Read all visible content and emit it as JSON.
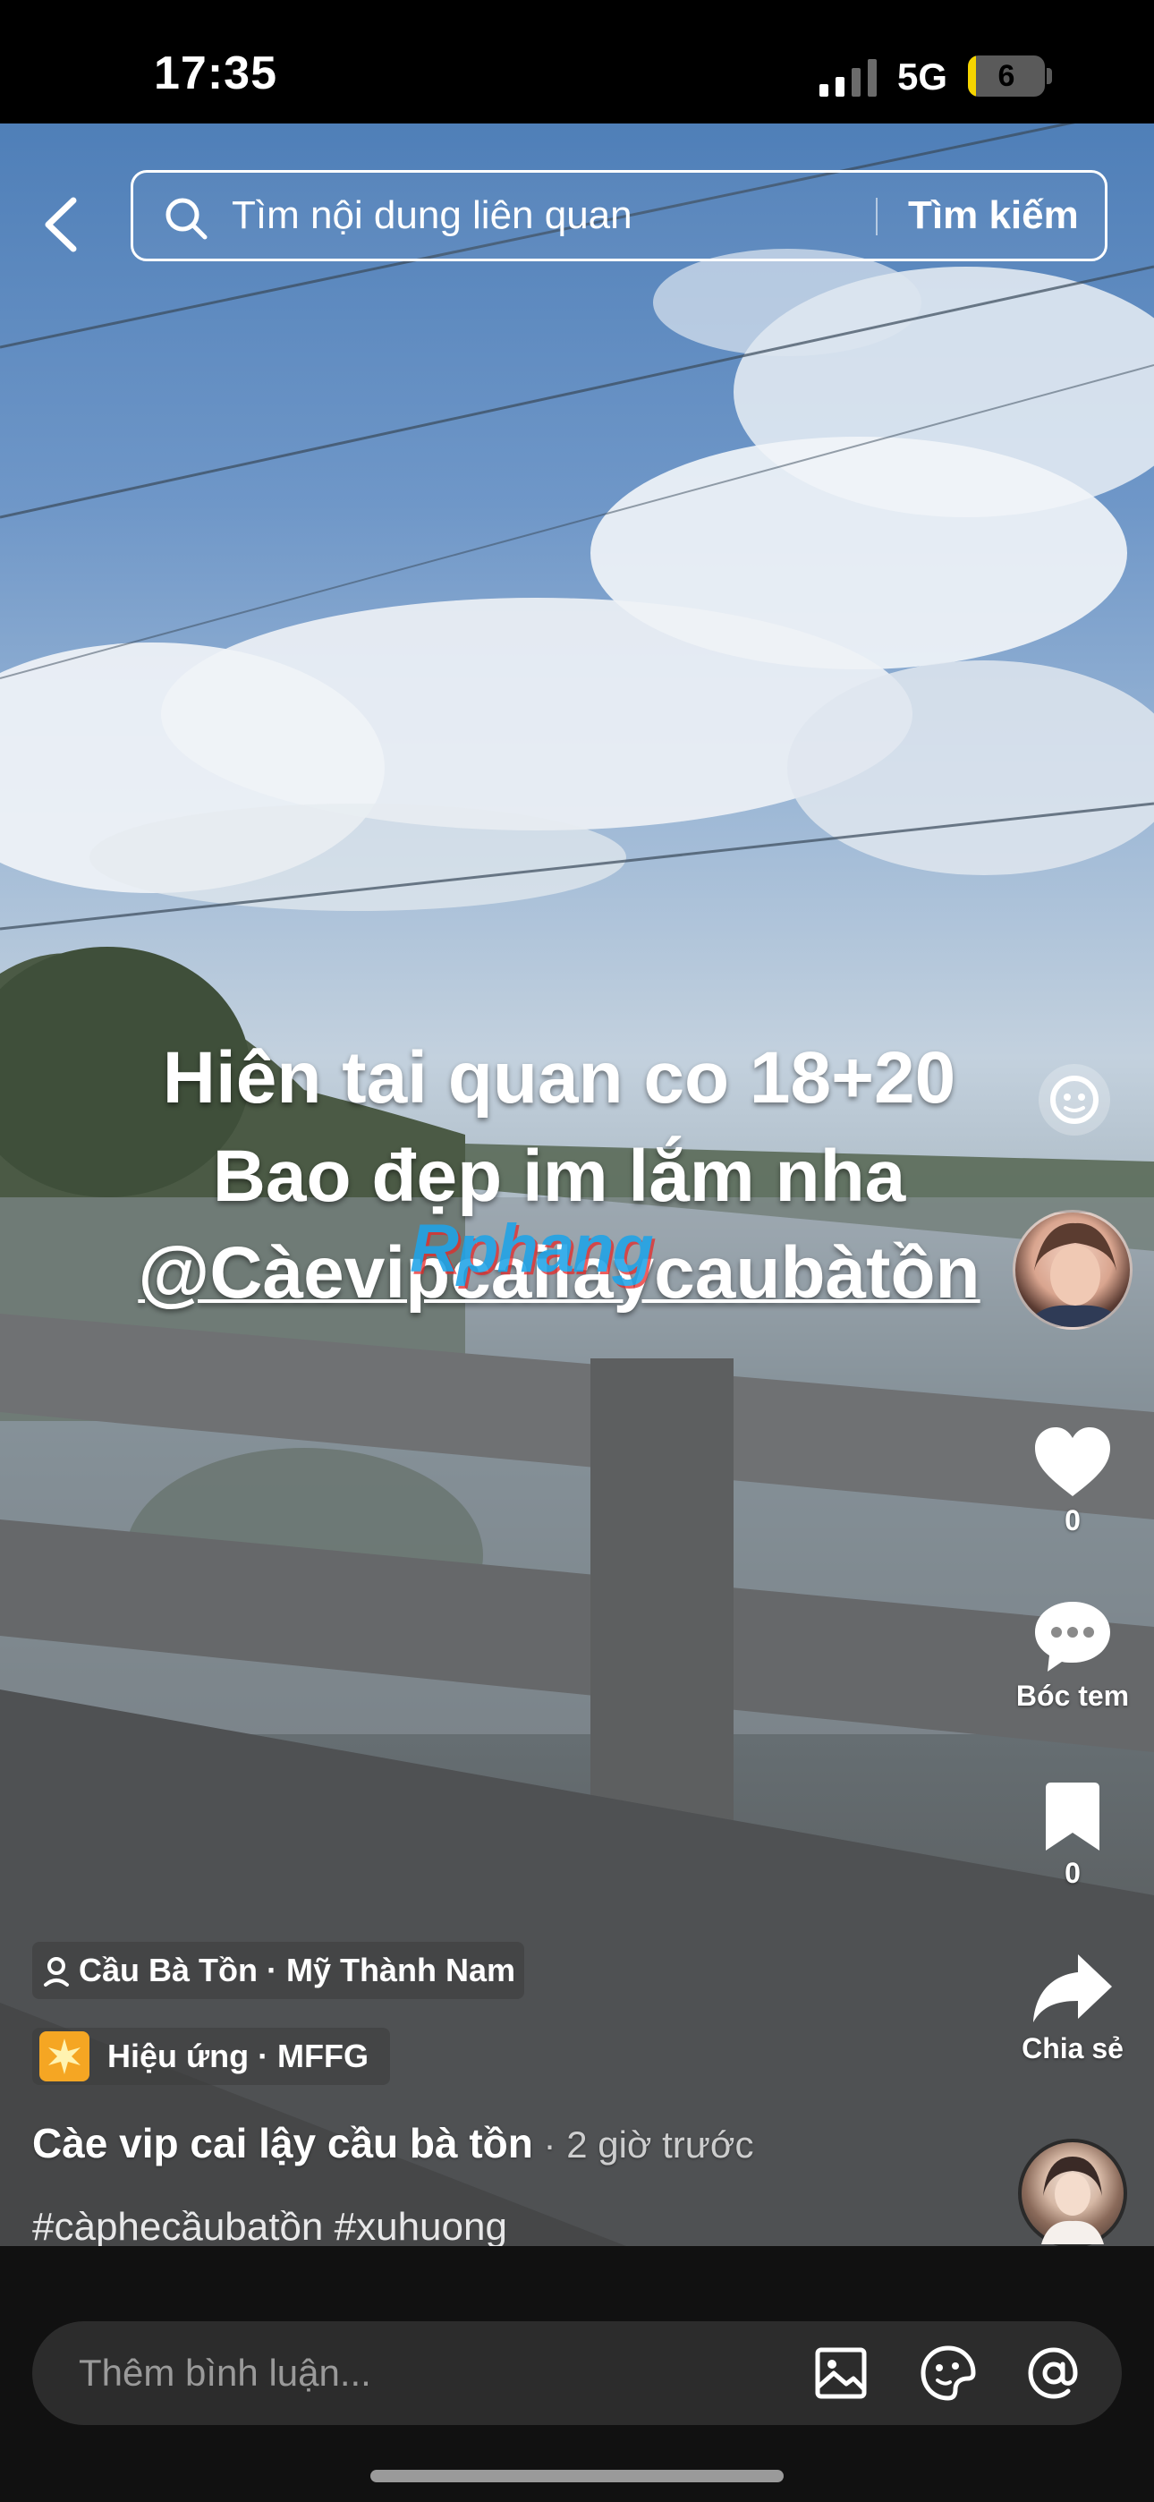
{
  "status_bar": {
    "time": "17:35",
    "network": "5G",
    "battery": "6",
    "battery_level": 0.06
  },
  "search": {
    "placeholder": "Tìm nội dung liên quan",
    "submit_label": "Tìm kiếm"
  },
  "video": {
    "overlay_lines": [
      "Hiên tai quan co 18+20",
      "Bao đẹp im lắm nha",
      "@Càevipcailaycaubàtồn"
    ],
    "watermark": "Rphang"
  },
  "side_actions": {
    "like_count": "0",
    "comment_label": "Bóc tem",
    "save_count": "0",
    "share_label": "Chia sẻ"
  },
  "post": {
    "location": "Cầu Bà Tồn · Mỹ Thành Nam",
    "effect": "Hiệu ứng · MFFG",
    "caption": "Càe vip cai lậy cầu bà tồn",
    "time": " · 2 giờ trước",
    "hashtags": "#càphecầubatồn #xuhuong"
  },
  "comment": {
    "placeholder": "Thêm bình luận..."
  }
}
